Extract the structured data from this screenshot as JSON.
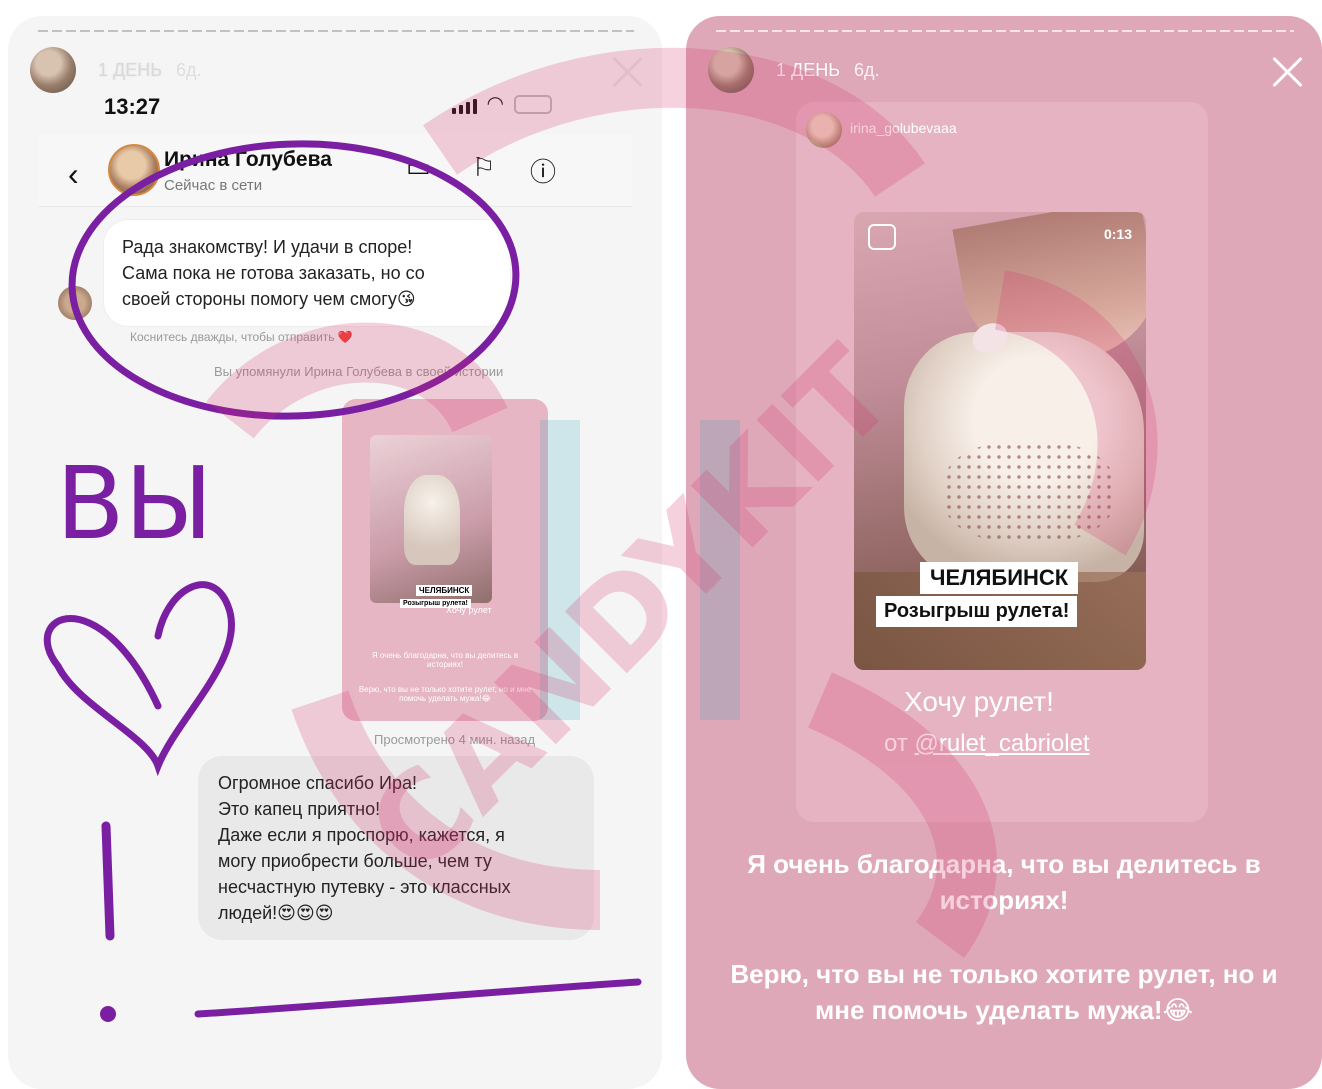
{
  "left_story": {
    "time_label": "1 ДЕНЬ",
    "ago": "6д."
  },
  "status_bar": {
    "time": "13:27"
  },
  "chat": {
    "back_icon": "chevron-left-icon",
    "contact_name": "Ирина Голубева",
    "contact_status": "Сейчас в сети",
    "first_message_lines": [
      "Рада знакомству! И удачи в споре!",
      "Сама пока не готова заказать, но со",
      "своей стороны помогу чем смогу😘"
    ],
    "tap_hint": "Коснитесь дважды, чтобы отправить ❤️",
    "mention_note": "Вы упомянули Ирина Голубева в своей истории",
    "mini_story": {
      "label1": "ЧЕЛЯБИНСК",
      "label2": "Розыгрыш рулета!",
      "caption": "Хочу рулет",
      "text1": "Я очень благодарна, что вы делитесь в историях!",
      "text2": "Верю, что вы не только хотите рулет, но и мне помочь уделать мужа!😂"
    },
    "viewed_note": "Просмотрено 4 мин. назад",
    "second_message_lines": [
      "Огромное спасибо Ира!",
      "Это капец приятно!",
      "Даже если я проспорю, кажется, я",
      "могу приобрести больше, чем ту",
      "несчастную путевку - это классных",
      "людей!😍😍😍"
    ]
  },
  "annotation": {
    "text": "ВЫ",
    "color": "#7b1fa2"
  },
  "right_story": {
    "time_label": "1 ДЕНЬ",
    "ago": "6д.",
    "card_user": "irina_golubevaaa",
    "video_duration": "0:13",
    "tag_city": "ЧЕЛЯБИНСК",
    "tag_title": "Розыгрыш рулета!",
    "video_user": "rulet_cabriolet",
    "want_text": "Хочу рулет!",
    "from_prefix": "от",
    "from_handle": "@rulet_cabriolet",
    "grateful_text": "Я очень благодарна, что вы делитесь в историях!",
    "believe_text": "Верю, что вы не только хотите рулет, но и мне помочь уделать мужа!😂",
    "background_color": "#dfa8b8"
  },
  "watermark": {
    "text": "CANDYKIT"
  }
}
